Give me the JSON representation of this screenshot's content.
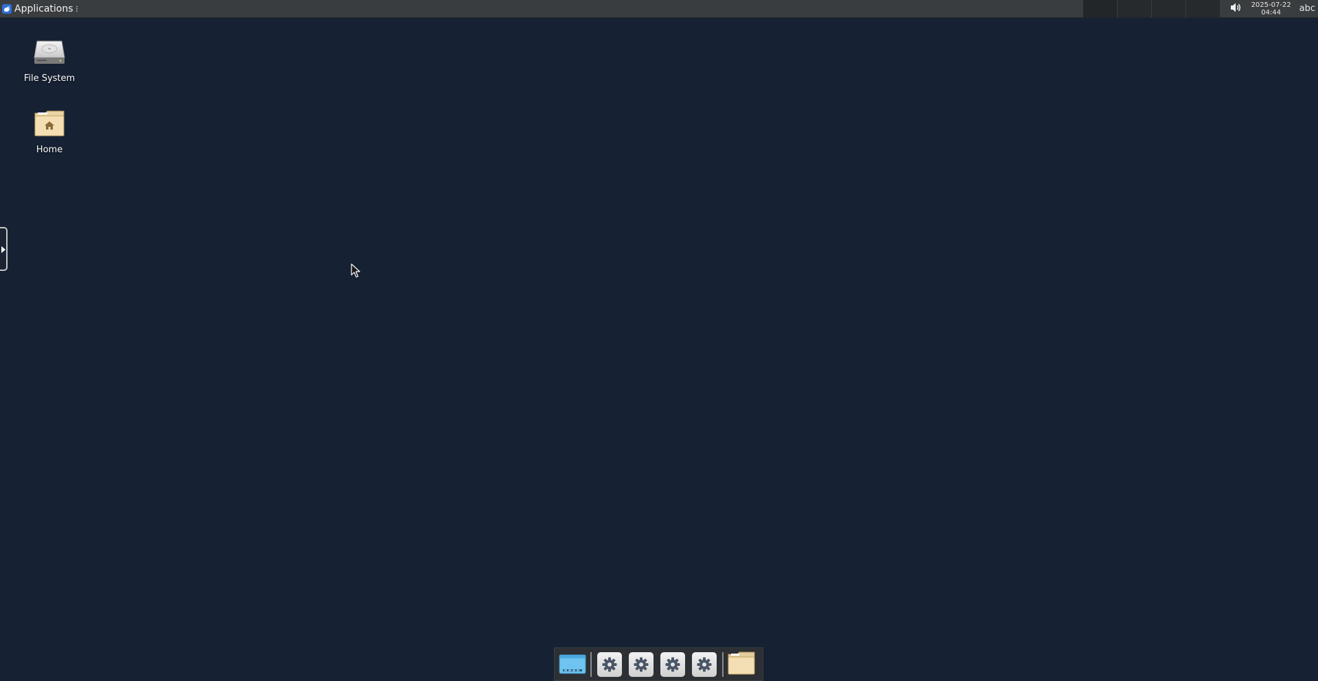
{
  "top_panel": {
    "applications_label": "Applications",
    "workspace_count": 4,
    "clock": {
      "date": "2025-07-22",
      "time": "04:44"
    },
    "keyboard_layout": "abc",
    "volume_icon": "volume-icon"
  },
  "desktop": {
    "icons": [
      {
        "label": "File System",
        "icon": "drive-icon"
      },
      {
        "label": "Home",
        "icon": "home-folder-icon"
      }
    ]
  },
  "dock": {
    "items": [
      {
        "name": "show-desktop",
        "icon": "desktop-icon"
      },
      {
        "name": "settings-1",
        "icon": "gear-icon"
      },
      {
        "name": "settings-2",
        "icon": "gear-icon"
      },
      {
        "name": "settings-3",
        "icon": "gear-icon"
      },
      {
        "name": "settings-4",
        "icon": "gear-icon"
      },
      {
        "name": "file-manager",
        "icon": "folder-icon"
      }
    ]
  },
  "colors": {
    "desktop_background": "#162133",
    "panel_background": "#3a3d3f",
    "dock_background": "#2c2f33"
  }
}
